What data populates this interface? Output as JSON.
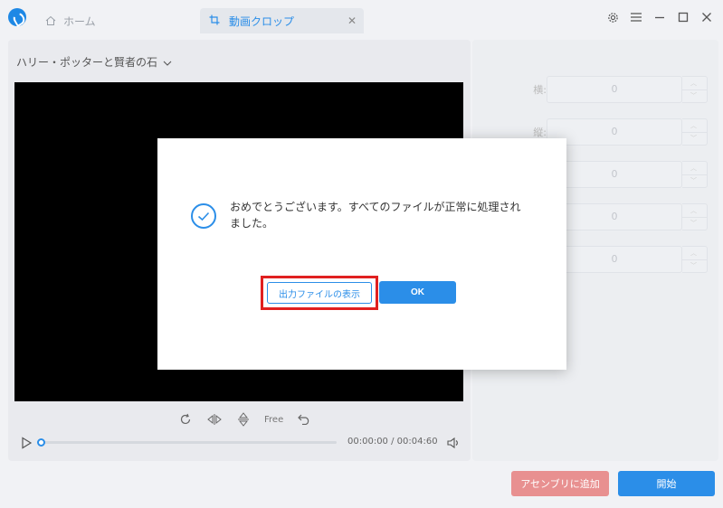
{
  "titlebar": {
    "home_tab": "ホーム",
    "crop_tab": "動画クロップ"
  },
  "video": {
    "title": "ハリー・ポッターと賢者の石"
  },
  "tools": {
    "free_label": "Free"
  },
  "player": {
    "time": "00:00:00 / 00:04:60",
    "progress": 0
  },
  "fields": [
    {
      "label": "横:",
      "value": "0"
    },
    {
      "label": "縦:",
      "value": "0"
    },
    {
      "label": "",
      "value": "0"
    },
    {
      "label": "",
      "value": "0"
    },
    {
      "label": "",
      "value": "0"
    }
  ],
  "buttons": {
    "add_to_assembly": "アセンブリに追加",
    "start": "開始"
  },
  "dialog": {
    "message": "おめでとうございます。すべてのファイルが正常に処理されました。",
    "show_output": "出力ファイルの表示",
    "ok": "OK"
  },
  "colors": {
    "accent": "#2b8ee8",
    "highlight": "#e02020",
    "assembly_button": "#e89090"
  }
}
